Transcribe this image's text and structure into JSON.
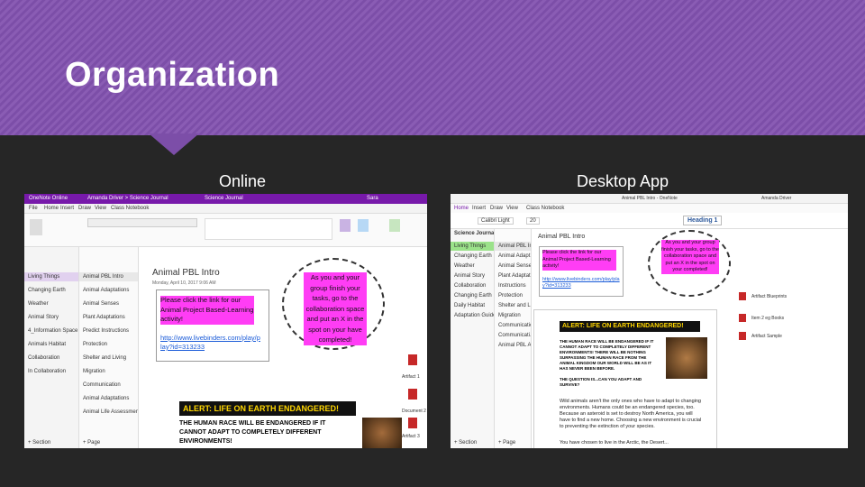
{
  "title": "Organization",
  "captions": {
    "online": "Online",
    "desktop": "Desktop App"
  },
  "online": {
    "titlebar": "OneNote Online",
    "breadcrumb": "Amanda Driver > Science Journal",
    "notebook": "Science Journal",
    "user": "Sara",
    "menu": [
      "File",
      "Home",
      "Insert",
      "Draw",
      "View",
      "Class Notebook"
    ],
    "sections": [
      "Living Things",
      "Changing Earth",
      "Weather",
      "Animal Story",
      "4_Information Space",
      "Animals Habitat",
      "Collaboration",
      "In Collaboration"
    ],
    "pages": [
      "Animal PBL Intro",
      "Animal Adaptations",
      "Animal Senses",
      "Plant Adaptations",
      "Predict Instructions",
      "Protection",
      "Shelter and Living",
      "Migration",
      "Communication",
      "Animal Adaptations",
      "Animal Life Assessment"
    ],
    "page_title": "Animal PBL Intro",
    "page_date": "Monday, April 10, 2017   9:06 AM",
    "instruction": "Please click the link for our Animal Project Based-Learning activity!",
    "link": "http://www.livebinders.com/play/play?id=313233",
    "oval_text": "As you and your group finish your tasks, go to the collaboration space and put an X in the spot on your have completed!",
    "attachments": [
      "Artifact 1",
      "Document 2",
      "Artifact 3"
    ],
    "alert_banner": "ALERT: LIFE ON EARTH ENDANGERED!",
    "alert_text": "THE HUMAN RACE WILL BE ENDANGERED IF IT CANNOT ADAPT TO COMPLETELY DIFFERENT ENVIRONMENTS!",
    "add_section": "+ Section",
    "add_page": "+ Page"
  },
  "desktop": {
    "titlebar": "Animal PBL Intro - OneNote",
    "user": "Amanda Driver",
    "menu": [
      "Home",
      "Insert",
      "Draw",
      "View",
      "Class Notebook"
    ],
    "font": "Calibri Light",
    "font_size": "20",
    "style": "Heading 1",
    "notebook": "Science Journal",
    "sections": [
      "Living Things",
      "Changing Earth",
      "Weather",
      "Animal Story",
      "Collaboration",
      "Changing Earth",
      "Daily Habitat",
      "Adaptation Guide"
    ],
    "pages": [
      "Animal PBL Intro",
      "Animal Adapt...",
      "Animal Senses",
      "Plant Adaptati...",
      "Instructions",
      "Protection",
      "Shelter and Li...",
      "Migration",
      "Communication",
      "Communicati...",
      "Animal PBL Ass..."
    ],
    "page_title": "Animal PBL Intro",
    "instruction": "Please click the link for our Animal Project Based-Learning activity!",
    "link": "http://www.livebinders.com/play/play?id=313233",
    "oval_text": "As you and your group finish your tasks, go to the collaboration space and put an X in the spot on your completed!",
    "files": [
      "Artifact Blueprints",
      "Item 2 eg Books",
      "Artifact Sample"
    ],
    "alert_banner": "ALERT: LIFE ON EARTH ENDANGERED!",
    "alert_text": "THE HUMAN RACE WILL BE ENDANGERED IF IT CANNOT ADAPT TO COMPLETELY DIFFERENT ENVIRONMENTS! THERE WILL BE NOTHING SURPASSING THE HUMAN RACE FROM THE ANIMAL KINGDOM OUR WORLD WILL BE AS IT HAS NEVER BEEN BEFORE.",
    "question": "THE QUESTION IS...CAN YOU ADAPT AND SURVIVE?",
    "body_text": "Wild animals aren't the only ones who have to adapt to changing environments. Humans could be an endangered species, too. Because an asteroid is set to destroy North America, you will have to find a new home. Choosing a new environment is crucial to preventing the extinction of your species.",
    "body_text2": "You have chosen to live in the Arctic, the Desert...",
    "add_section": "+ Section",
    "add_page": "+ Page"
  },
  "colors": {
    "accent": "#7c4ea8",
    "onenote": "#7719aa",
    "highlight": "#ff3df5"
  }
}
